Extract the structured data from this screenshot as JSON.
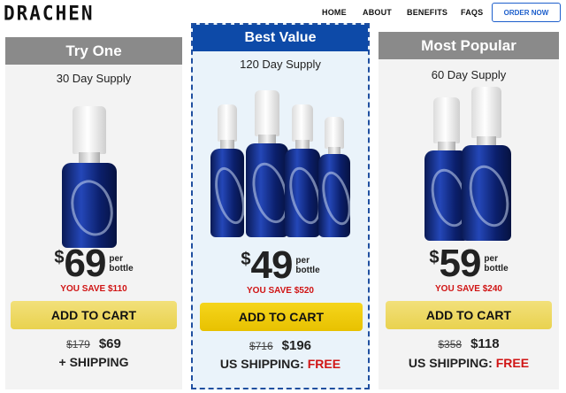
{
  "header": {
    "logo": "DRACHEN",
    "nav": [
      "HOME",
      "ABOUT",
      "BENEFITS",
      "FAQS"
    ],
    "order_button": "ORDER NOW"
  },
  "offers": [
    {
      "banner": "Try One",
      "supply": "30 Day Supply",
      "price_symbol": "$",
      "price": "69",
      "per_label_1": "per",
      "per_label_2": "bottle",
      "you_save": "YOU SAVE $110",
      "button": "ADD TO CART",
      "old_total": "$179",
      "new_total": "$69",
      "shipping": "+ SHIPPING",
      "shipping_free": ""
    },
    {
      "banner": "Best Value",
      "supply": "120 Day Supply",
      "price_symbol": "$",
      "price": "49",
      "per_label_1": "per",
      "per_label_2": "bottle",
      "you_save": "YOU SAVE $520",
      "button": "ADD TO CART",
      "old_total": "$716",
      "new_total": "$196",
      "shipping": "US SHIPPING: ",
      "shipping_free": "FREE"
    },
    {
      "banner": "Most Popular",
      "supply": "60 Day Supply",
      "price_symbol": "$",
      "price": "59",
      "per_label_1": "per",
      "per_label_2": "bottle",
      "you_save": "YOU SAVE $240",
      "button": "ADD TO CART",
      "old_total": "$358",
      "new_total": "$118",
      "shipping": "US SHIPPING: ",
      "shipping_free": "FREE"
    }
  ],
  "colors": {
    "best_banner": "#0d4aa8",
    "banner_gray": "#8a8a8a",
    "save_red": "#d01414",
    "button_yellow": "#f5d51c"
  }
}
